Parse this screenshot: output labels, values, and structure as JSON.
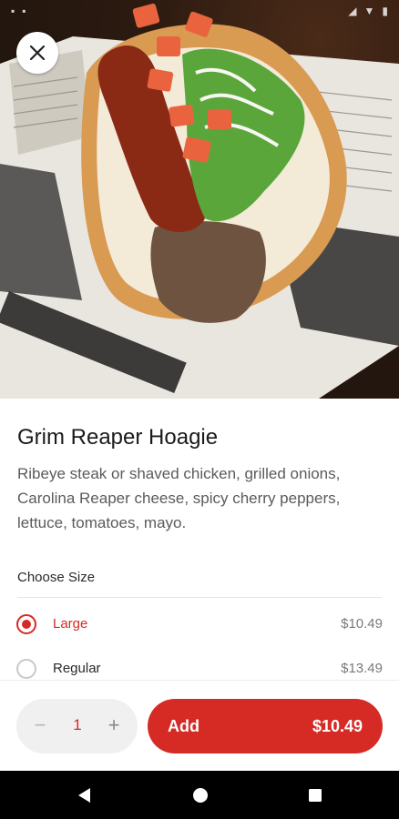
{
  "status_bar": {
    "time": "",
    "icons": [
      "signal-icon",
      "wifi-icon",
      "battery-icon"
    ]
  },
  "item": {
    "title": "Grim Reaper Hoagie",
    "description": "Ribeye steak or shaved chicken, grilled onions, Carolina Reaper cheese, spicy cherry peppers, lettuce, tomatoes, mayo."
  },
  "size_section": {
    "title": "Choose Size",
    "options": [
      {
        "label": "Large",
        "price": "$10.49",
        "selected": true
      },
      {
        "label": "Regular",
        "price": "$13.49",
        "selected": false
      }
    ]
  },
  "order": {
    "minus_symbol": "−",
    "quantity": "1",
    "plus_symbol": "+",
    "add_label": "Add",
    "total": "$10.49"
  },
  "colors": {
    "accent": "#d62a25",
    "text": "#1b1b1b",
    "muted": "#5b5b5b"
  }
}
